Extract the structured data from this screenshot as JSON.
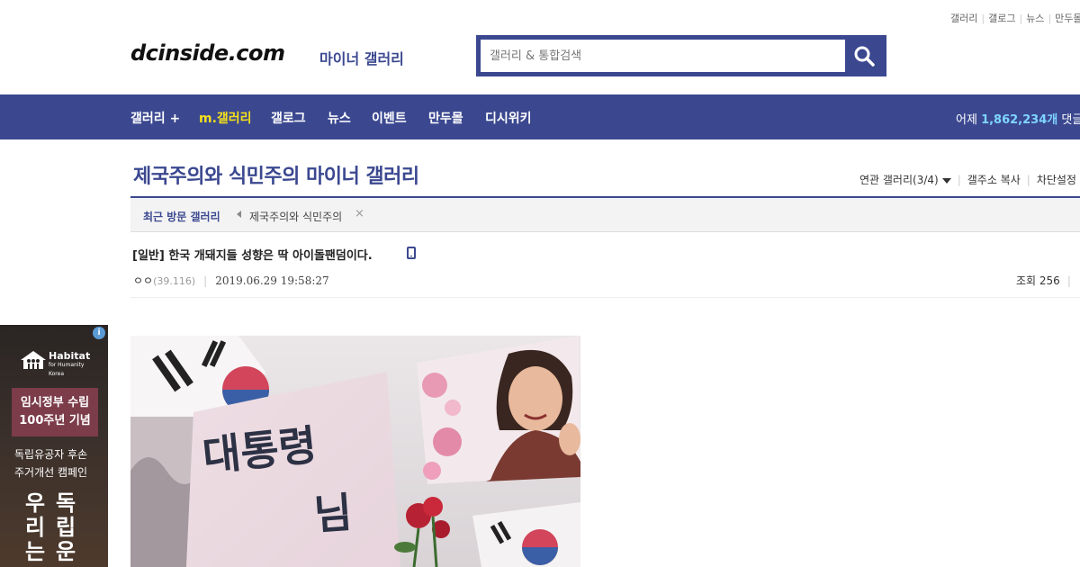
{
  "topbar": {
    "links": [
      "갤러리",
      "갤로그",
      "뉴스",
      "만두몰"
    ]
  },
  "header": {
    "logo": "dcinside.com",
    "logo_sub": "마이너 갤러리",
    "search_placeholder": "갤러리 & 통합검색"
  },
  "nav": {
    "items": [
      {
        "label": "갤러리 +",
        "active": false
      },
      {
        "label": "m.갤러리",
        "active": true
      },
      {
        "label": "갤로그",
        "active": false
      },
      {
        "label": "뉴스",
        "active": false
      },
      {
        "label": "이벤트",
        "active": false
      },
      {
        "label": "만두몰",
        "active": false
      },
      {
        "label": "디시위키",
        "active": false
      }
    ],
    "stat_prefix": "어제",
    "stat_value": "1,862,234개",
    "stat_suffix": "댓글"
  },
  "gallery": {
    "title": "제국주의와 식민주의 마이너 갤러리",
    "related": "연관 갤러리(3/4)",
    "copy_addr": "갤주소 복사",
    "block_settings": "차단설정"
  },
  "recent": {
    "label": "최근 방문 갤러리",
    "visited": "제국주의와 식민주의",
    "close": "×"
  },
  "post": {
    "title": "[일반] 한국 개돼지들 성향은 딱 아이돌팬덤이다.",
    "author": "ㅇㅇ",
    "ip": "(39.116)",
    "date": "2019.06.29 19:58:27",
    "views_label": "조회 256"
  },
  "ad": {
    "info": "i",
    "brand": "Habitat",
    "brand_line2": "for Humanity",
    "brand_small": "Korea",
    "box_line1": "임시정부 수립",
    "box_line2": "100주년 기념",
    "copy_line1": "독립유공자 후손",
    "copy_line2": "주거개선 캠페인",
    "big_col1": "우리는",
    "big_col2": "독립운"
  },
  "photo": {
    "sign_text": "대통령님",
    "sign_text_2": "님"
  },
  "colors": {
    "brand": "#3b4890",
    "nav_active": "#f5e01a",
    "stat": "#7fd5ff"
  }
}
